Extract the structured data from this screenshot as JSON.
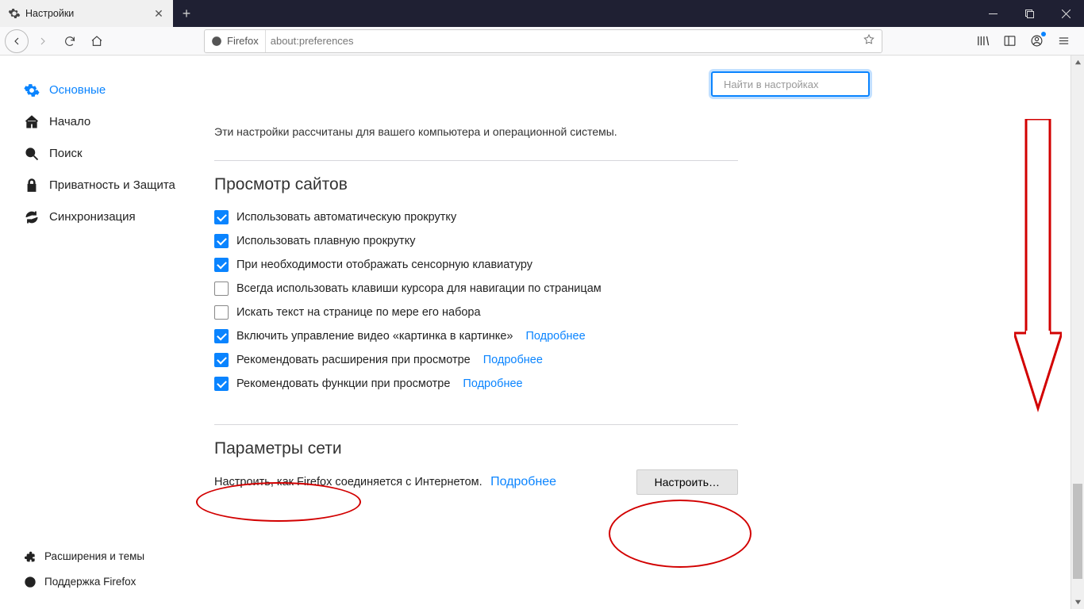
{
  "tab": {
    "title": "Настройки"
  },
  "urlbar": {
    "identity": "Firefox",
    "url": "about:preferences"
  },
  "search": {
    "placeholder": "Найти в настройках"
  },
  "sidebar": {
    "items": [
      {
        "label": "Основные"
      },
      {
        "label": "Начало"
      },
      {
        "label": "Поиск"
      },
      {
        "label": "Приватность и Защита"
      },
      {
        "label": "Синхронизация"
      }
    ],
    "bottom": [
      {
        "label": "Расширения и темы"
      },
      {
        "label": "Поддержка Firefox"
      }
    ]
  },
  "main": {
    "intro": "Эти настройки рассчитаны для вашего компьютера и операционной системы.",
    "browsing_title": "Просмотр сайтов",
    "checks": [
      {
        "checked": true,
        "label": "Использовать автоматическую прокрутку"
      },
      {
        "checked": true,
        "label": "Использовать плавную прокрутку"
      },
      {
        "checked": true,
        "label": "При необходимости отображать сенсорную клавиатуру"
      },
      {
        "checked": false,
        "label": "Всегда использовать клавиши курсора для навигации по страницам"
      },
      {
        "checked": false,
        "label": "Искать текст на странице по мере его набора"
      },
      {
        "checked": true,
        "label": "Включить управление видео «картинка в картинке»",
        "link": "Подробнее"
      },
      {
        "checked": true,
        "label": "Рекомендовать расширения при просмотре",
        "link": "Подробнее"
      },
      {
        "checked": true,
        "label": "Рекомендовать функции при просмотре",
        "link": "Подробнее"
      }
    ],
    "network_title": "Параметры сети",
    "network_text": "Настроить, как Firefox соединяется с Интернетом.",
    "network_link": "Подробнее",
    "network_button": "Настроить…"
  }
}
